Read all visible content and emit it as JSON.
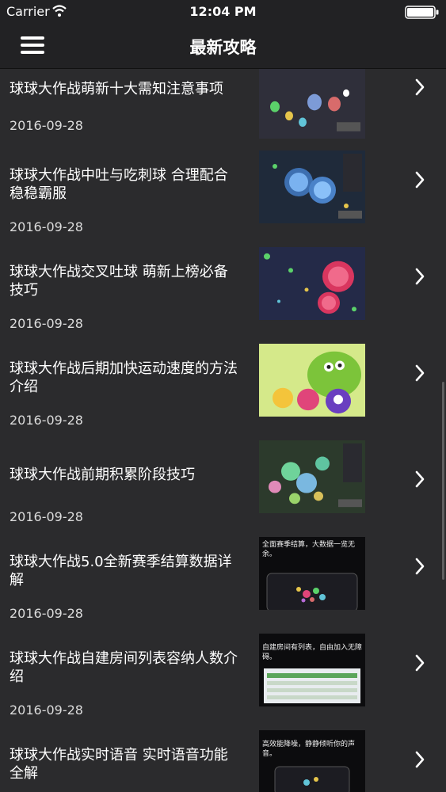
{
  "status_bar": {
    "carrier": "Carrier",
    "time": "12:04 PM"
  },
  "navbar": {
    "title": "最新攻略"
  },
  "articles": [
    {
      "title": "球球大作战萌新十大需知注意事项",
      "date": "2016-09-28",
      "thumb_overlay": ""
    },
    {
      "title": "球球大作战中吐与吃刺球 合理配合稳稳霸服",
      "date": "2016-09-28",
      "thumb_overlay": ""
    },
    {
      "title": "球球大作战交叉吐球 萌新上榜必备技巧",
      "date": "2016-09-28",
      "thumb_overlay": ""
    },
    {
      "title": "球球大作战后期加快运动速度的方法介绍",
      "date": "2016-09-28",
      "thumb_overlay": ""
    },
    {
      "title": "球球大作战前期积累阶段技巧",
      "date": "2016-09-28",
      "thumb_overlay": ""
    },
    {
      "title": "球球大作战5.0全新赛季结算数据详解",
      "date": "2016-09-28",
      "thumb_overlay": "全面赛季结算，大数据一览无余。"
    },
    {
      "title": "球球大作战自建房间列表容纳人数介绍",
      "date": "2016-09-28",
      "thumb_overlay": "自建房间有列表，自由加入无障碍。"
    },
    {
      "title": "球球大作战实时语音 实时语音功能全解",
      "date": "",
      "thumb_overlay": "高效能降噪，静静倾听你的声音。"
    }
  ]
}
